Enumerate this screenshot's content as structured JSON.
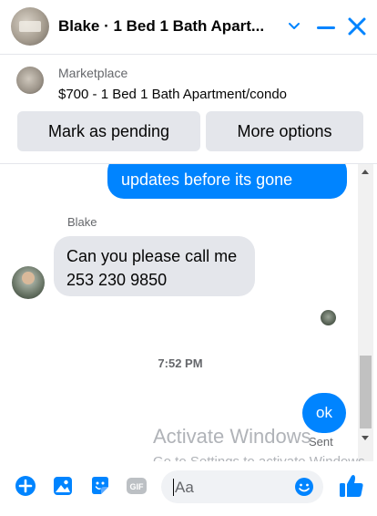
{
  "header": {
    "title": "Blake · 1 Bed 1 Bath Apart...",
    "avatar_icon": "listing-photo-avatar",
    "chevron_icon": "chevron-down-icon",
    "minimize_icon": "minimize-icon",
    "close_icon": "close-icon"
  },
  "marketplace": {
    "label": "Marketplace",
    "listing": "$700 - 1 Bed 1 Bath Apartment/condo",
    "mark_pending": "Mark as pending",
    "more_options": "More options"
  },
  "thread": {
    "my_message": "updates before its gone",
    "sender_name": "Blake",
    "their_message_line1": "Can you please call me",
    "their_message_line2": "253 230 9850",
    "timestamp": "7:52 PM",
    "my_reply": "ok",
    "reply_status": "Sent"
  },
  "watermark": {
    "line1": "Activate Windows",
    "line2": "Go to Settings to activate Windows."
  },
  "composer": {
    "placeholder": "Aa",
    "gif_label": "GIF",
    "icons": [
      "plus-icon",
      "photo-icon",
      "sticker-icon",
      "gif-icon",
      "emoji-icon",
      "thumbs-up-icon"
    ]
  },
  "colors": {
    "accent": "#0084ff",
    "bubble_gray": "#e4e6eb",
    "muted_text": "#65676b"
  }
}
